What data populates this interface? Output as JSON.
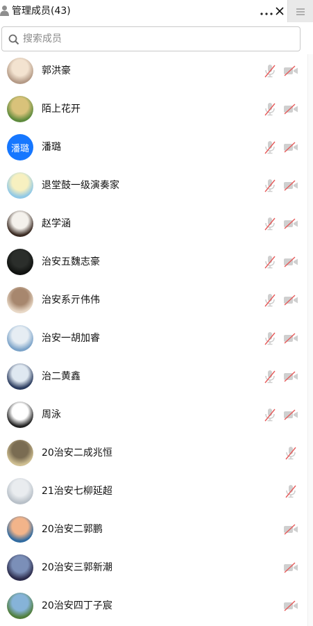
{
  "header": {
    "title": "管理成员(43)",
    "more_icon": "more-icon",
    "close_icon": "close-icon",
    "menu_icon": "menu-icon"
  },
  "search": {
    "placeholder": "搜索成员",
    "value": ""
  },
  "members": [
    {
      "name": "郭洪豪",
      "mic_muted": true,
      "camera_off": true
    },
    {
      "name": "陌上花开",
      "mic_muted": true,
      "camera_off": true
    },
    {
      "name": "潘璐",
      "avatar_text": "潘璐",
      "avatar_color": "#1677ff",
      "mic_muted": true,
      "camera_off": true
    },
    {
      "name": "退堂鼓一级演奏家",
      "mic_muted": true,
      "camera_off": true
    },
    {
      "name": "赵学涵",
      "mic_muted": true,
      "camera_off": true
    },
    {
      "name": "治安五魏志豪",
      "mic_muted": true,
      "camera_off": true
    },
    {
      "name": "治安系亓伟伟",
      "mic_muted": true,
      "camera_off": true
    },
    {
      "name": "治安一胡加睿",
      "mic_muted": true,
      "camera_off": true
    },
    {
      "name": "治二黄鑫",
      "mic_muted": true,
      "camera_off": true
    },
    {
      "name": "周泳",
      "mic_muted": true,
      "camera_off": true
    },
    {
      "name": "20治安二成兆恒",
      "mic_muted": true,
      "camera_off": false
    },
    {
      "name": "21治安七柳延超",
      "mic_muted": true,
      "camera_off": false
    },
    {
      "name": "20治安二郭鹏",
      "mic_muted": false,
      "camera_off": true
    },
    {
      "name": "20治安三郭新潮",
      "mic_muted": false,
      "camera_off": true
    },
    {
      "name": "20治安四丁子宸",
      "mic_muted": false,
      "camera_off": true
    }
  ],
  "colors": {
    "accent": "#1677ff",
    "muted_slash": "#e65a5a",
    "icon_gray": "#c8c8c8"
  }
}
